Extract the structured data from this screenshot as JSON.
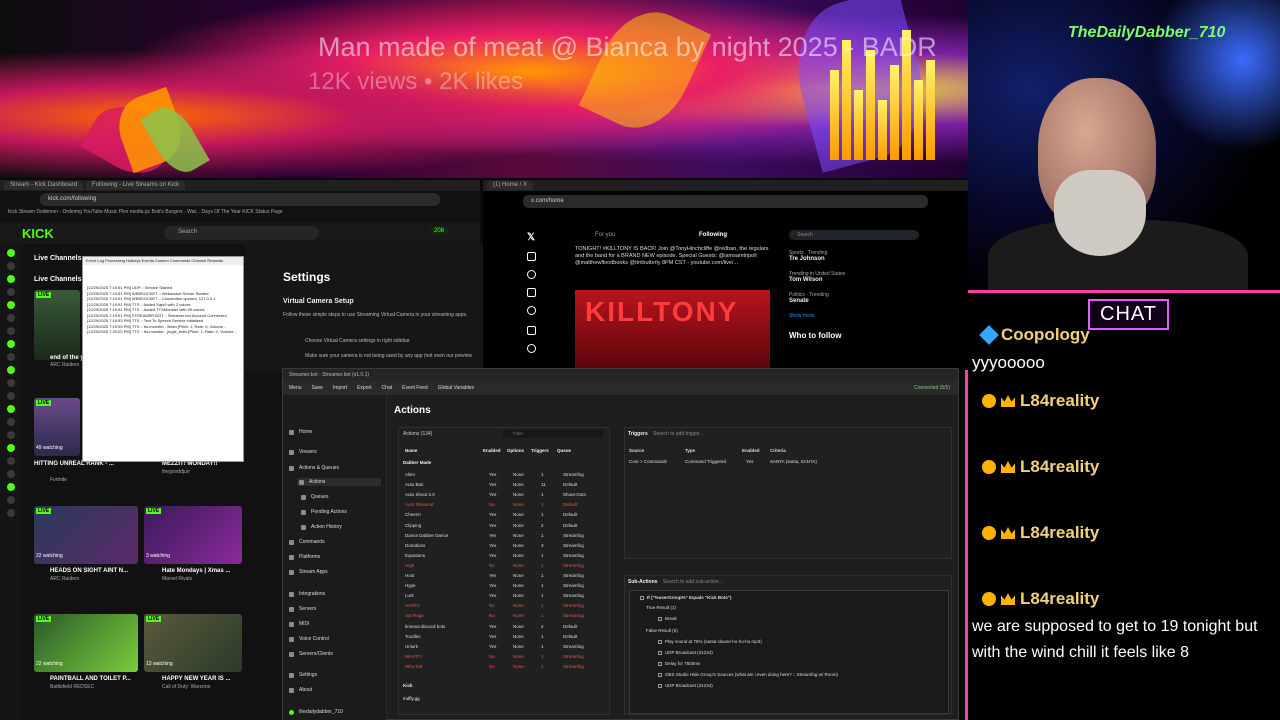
{
  "banner": {
    "title": "Man made of meat @ Bianca by night 2025 - BADR",
    "subtitle": "12K views • 2K likes"
  },
  "webcam": {
    "overlay_name": "TheDailyDabber_710"
  },
  "chat": {
    "title": "CHAT",
    "messages": [
      {
        "user": "Coopology",
        "text": "yyyooooo"
      },
      {
        "user": "L84reality",
        "text": ""
      },
      {
        "user": "L84reality",
        "text": ""
      },
      {
        "user": "L84reality",
        "text": ""
      },
      {
        "user": "L84reality",
        "text": "we are supposed to get to 19 tonight but with the wind chill it feels like 8"
      }
    ]
  },
  "kick_browser": {
    "tabs": [
      "Stream - Kick Dashboard",
      "Following - Live Streams on Kick"
    ],
    "address": "kick.com/following",
    "bookmarks": "Kick Stream   Dodemon - Ordering   YouTube Music   Plex   media.pc   Bob's Burgers - Wat...   Days Of The Year   KICK Status Page",
    "logo": "KICK",
    "search_placeholder": "Search",
    "live_channels_label": "Live Channels",
    "follow_count": "208",
    "cards": [
      {
        "title": "end of the y...",
        "sub": "ARC Raiders",
        "viewers": ""
      },
      {
        "title": "HITTING UNREAL RANK - ...",
        "sub": "Fortnite",
        "viewers": "49 watching"
      },
      {
        "title": "MEZZIT! MONDAY!!",
        "sub": "thegooddjurr",
        "viewers": ""
      },
      {
        "title": "HEADS ON SIGHT AINT N...",
        "sub": "ARC Raiders",
        "viewers": "22 watching"
      },
      {
        "title": "Hate Mondays | Xmas ...",
        "sub": "Marvel Rivals",
        "viewers": "3 watching"
      },
      {
        "title": "PAINTBALL AND TOILET P...",
        "sub": "Battlefield REDSEC",
        "viewers": "22 watching"
      },
      {
        "title": "HAPPY NEW YEAR IS ...",
        "sub": "Call of Duty: Warzone",
        "viewers": "13 watching"
      }
    ]
  },
  "sb_log": {
    "lines": [
      "[12/29/2025 7:19:51 PM] UDP :: Service Started",
      "[12/29/2025 7:19:51 PM] WEBSOCKET :: Websocket Server Started",
      "[12/29/2025 7:19:51 PM] WEBSOCKET :: Connection opened, 127.0.0.1",
      "[12/29/2025 7:19:51 PM] TTS :: Added Sapi5 with 2 voices",
      "[12/29/2025 7:19:51 PM] TTS :: Added TTSMonster with 99 voices",
      "[12/29/2025 7:19:51 PM] STREAMER.BOT :: Streamer.bot Account Connected",
      "[12/29/2025 7:19:53 PM] TTS :: Text To Speech Service initialized",
      "[12/29/2025 7:19:59 PM] TTS :: tts-monster - Brian [Pitch: 1, Rate: 0, Volume...",
      "[12/29/2025 7:20:02 PM] TTS :: tts-monster - jingle_bells [Pitch: 1, Rate: 0, Volume..."
    ],
    "tabs": "Event Log   Processing   Hotkeys   Events   Custom Commands   Channel Rewards"
  },
  "kick_settings": {
    "title": "Settings",
    "section": "Virtual Camera Setup",
    "desc": "Follow these simple steps to use Streaming Virtual Camera in your streaming apps.",
    "step1": "Choose Virtual Camera settings in right sidebar",
    "step2": "Make sure your camera is not being used by any app (not even our preview"
  },
  "twitter": {
    "address": "x.com/home",
    "for_you": "For you",
    "following": "Following",
    "search": "Search",
    "tweet": "TONIGHT! #KILLTONY IS BACK! Join @TonyHinchcliffe @redban, the regulars and the band for a BRAND NEW episode. Special Guests: @iamsamtripoli @matthewfloodbooks @timbutterly  8PM CST - youtube.com/live/...",
    "img_text": "KILLTONY",
    "trends": [
      {
        "cat": "Sports · Trending",
        "name": "Tre Johnson"
      },
      {
        "cat": "Trending in United States",
        "name": "Tom Wilson"
      },
      {
        "cat": "Politics · Trending",
        "name": "Senate"
      }
    ],
    "show_more": "Show more",
    "who_to_follow": "Who to follow"
  },
  "streamerbot": {
    "window_title": "Streamer.bot - Streamer.bot (v1.0.1)",
    "menu": [
      "Menu",
      "Save",
      "Import",
      "Export",
      "Chat",
      "Event Feed",
      "Global Variables"
    ],
    "connected": "Connected (5/5)",
    "nav": [
      {
        "label": "Home"
      },
      {
        "label": "Viewers"
      },
      {
        "label": "Actions & Queues"
      },
      {
        "label": "Actions"
      },
      {
        "label": "Queues"
      },
      {
        "label": "Pending Actions"
      },
      {
        "label": "Action History"
      },
      {
        "label": "Commands"
      },
      {
        "label": "Platforms"
      },
      {
        "label": "Stream Apps"
      },
      {
        "label": "Integrations"
      },
      {
        "label": "Servers"
      },
      {
        "label": "MIDI"
      },
      {
        "label": "Voice Control"
      },
      {
        "label": "Servers/Clients"
      },
      {
        "label": "Settings"
      },
      {
        "label": "About"
      },
      {
        "label": "thedailydabber_710"
      }
    ],
    "heading": "Actions",
    "actions_count": "Actions (134)",
    "filter": "Filter",
    "columns": [
      "Name",
      "Enabled",
      "Options",
      "Triggers",
      "Queue"
    ],
    "group": "Dabber Made",
    "group2": "Kick",
    "group2_item": "mdfly.gg",
    "actions": [
      {
        "name": "Alien",
        "enabled": "Yes",
        "options": "None",
        "triggers": "1",
        "queue": "Streamfog",
        "disabled": false
      },
      {
        "name": "Auto Ban",
        "enabled": "Yes",
        "options": "None",
        "triggers": "11",
        "queue": "Default",
        "disabled": false
      },
      {
        "name": "Auto Shout 2.0",
        "enabled": "Yes",
        "options": "None",
        "triggers": "1",
        "queue": "Shout-Outs",
        "disabled": false
      },
      {
        "name": "Auto Shoutout",
        "enabled": "No",
        "options": "None",
        "triggers": "1",
        "queue": "Default",
        "disabled": true
      },
      {
        "name": "Cheers!",
        "enabled": "Yes",
        "options": "None",
        "triggers": "1",
        "queue": "Default",
        "disabled": false
      },
      {
        "name": "Clipping",
        "enabled": "Yes",
        "options": "None",
        "triggers": "2",
        "queue": "Default",
        "disabled": false
      },
      {
        "name": "Dance Dabber Dance",
        "enabled": "Yes",
        "options": "None",
        "triggers": "1",
        "queue": "Streamfog",
        "disabled": false
      },
      {
        "name": "Donations",
        "enabled": "Yes",
        "options": "None",
        "triggers": "3",
        "queue": "Streamfog",
        "disabled": false
      },
      {
        "name": "Equations",
        "enabled": "Yes",
        "options": "None",
        "triggers": "1",
        "queue": "Streamfog",
        "disabled": false
      },
      {
        "name": "High",
        "enabled": "No",
        "options": "None",
        "triggers": "1",
        "queue": "Streamfog",
        "disabled": true
      },
      {
        "name": "Host",
        "enabled": "Yes",
        "options": "None",
        "triggers": "1",
        "queue": "Streamfog",
        "disabled": false
      },
      {
        "name": "Hype",
        "enabled": "Yes",
        "options": "None",
        "triggers": "1",
        "queue": "Streamfog",
        "disabled": false
      },
      {
        "name": "Lurk",
        "enabled": "Yes",
        "options": "None",
        "triggers": "1",
        "queue": "Streamfog",
        "disabled": false
      },
      {
        "name": "SANTA",
        "enabled": "No",
        "options": "None",
        "triggers": "1",
        "queue": "Streamfog",
        "disabled": true
      },
      {
        "name": "Sat Rage",
        "enabled": "No",
        "options": "None",
        "triggers": "1",
        "queue": "Streamfog",
        "disabled": true
      },
      {
        "name": "timeout discord bots",
        "enabled": "Yes",
        "options": "None",
        "triggers": "2",
        "queue": "Default",
        "disabled": false
      },
      {
        "name": "Toodles",
        "enabled": "Yes",
        "options": "None",
        "triggers": "1",
        "queue": "Default",
        "disabled": false
      },
      {
        "name": "Unlurk",
        "enabled": "Yes",
        "options": "None",
        "triggers": "1",
        "queue": "Streamfog",
        "disabled": false
      },
      {
        "name": "WHAT!?",
        "enabled": "No",
        "options": "None",
        "triggers": "1",
        "queue": "Streamfog",
        "disabled": true
      },
      {
        "name": "Who Did",
        "enabled": "No",
        "options": "None",
        "triggers": "1",
        "queue": "Streamfog",
        "disabled": true
      }
    ],
    "triggers_title": "Triggers",
    "triggers_search": "Search to add trigger...",
    "trigger_columns": [
      "Source",
      "Type",
      "Enabled",
      "Criteria"
    ],
    "trigger_row": {
      "source": "Core > Commands",
      "type": "Command Triggered",
      "enabled": "Yes",
      "criteria": "SANTA (santa, SANTA)"
    },
    "subactions_title": "Sub-Actions",
    "subactions_search": "Search to add sub-action...",
    "subactions": [
      "If (\"%userGroup%\" Equals \"Kick Bots\")",
      "True Result (1)",
      "Break",
      "False Result (5)",
      "Play sound at 75% (santa-clause-ho-ho-ho.mp3)",
      "UDP Broadcast (41234)",
      "Delay for 7500ms",
      "OBS Studio Hide Group's Sources (what am i even doing here? :: Streamfog w/ Room)",
      "UDP Broadcast (41234)"
    ]
  }
}
